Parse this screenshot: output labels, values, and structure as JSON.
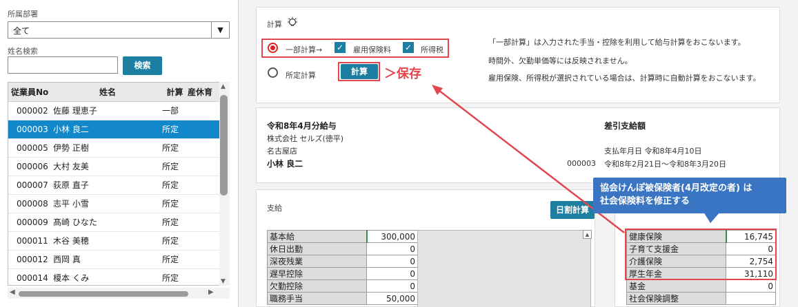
{
  "left": {
    "dept_label": "所属部署",
    "dept_value": "全て",
    "name_search_label": "姓名検索",
    "name_search_value": "",
    "search_button": "検索",
    "columns": [
      "従業員No",
      "姓名",
      "計算",
      "産休育"
    ],
    "rows": [
      {
        "no": "000002",
        "name": "佐藤 理恵子",
        "calc": "一部"
      },
      {
        "no": "000003",
        "name": "小林 良二",
        "calc": "所定"
      },
      {
        "no": "000005",
        "name": "伊勢 正樹",
        "calc": "所定"
      },
      {
        "no": "000006",
        "name": "大村 友美",
        "calc": "所定"
      },
      {
        "no": "000007",
        "name": "荻原 直子",
        "calc": "所定"
      },
      {
        "no": "000008",
        "name": "志平 小雪",
        "calc": "所定"
      },
      {
        "no": "000009",
        "name": "髙崎 ひなた",
        "calc": "所定"
      },
      {
        "no": "000011",
        "name": "木谷 美穂",
        "calc": "所定"
      },
      {
        "no": "000012",
        "name": "西岡 真",
        "calc": "所定"
      },
      {
        "no": "000014",
        "name": "榎本 くみ",
        "calc": "所定"
      }
    ]
  },
  "calc_panel": {
    "title": "計算",
    "partial_calc": "一部計算→",
    "employment_insurance": "雇用保険料",
    "income_tax": "所得税",
    "standard_calc": "所定計算",
    "calc_button": "計算",
    "save_annotation": "＞保存",
    "info_line1": "「一部計算」は入力された手当・控除を利用して給与計算をおこないます。",
    "info_line2": "時間外、欠勤単価等には反映されません。",
    "info_line3": "雇用保険、所得税が選択されている場合は、計算時に自動計算をおこないます。"
  },
  "header": {
    "pay_title": "令和8年4月分給与",
    "company": "株式会社 セルズ(徳平)",
    "branch": "名古屋店",
    "employee_name": "小林 良二",
    "employee_no": "000003",
    "net_pay_label": "差引支給額",
    "pay_date": "支払年月日 令和8年4月10日",
    "period": "令和8年2月21日～令和8年3月20日"
  },
  "payments": {
    "title": "支給",
    "daily_button": "日割計算",
    "rows": [
      {
        "label": "基本給",
        "value": "300,000"
      },
      {
        "label": "休日出勤",
        "value": "0"
      },
      {
        "label": "深夜残業",
        "value": "0"
      },
      {
        "label": "遅早控除",
        "value": "0"
      },
      {
        "label": "欠勤控除",
        "value": "0"
      },
      {
        "label": "職務手当",
        "value": "50,000"
      }
    ]
  },
  "deductions": {
    "rows": [
      {
        "label": "健康保険",
        "value": "16,745"
      },
      {
        "label": "子育て支援金",
        "value": "0"
      },
      {
        "label": "介護保険",
        "value": "2,754"
      },
      {
        "label": "厚生年金",
        "value": "31,110"
      },
      {
        "label": "基金",
        "value": "0"
      },
      {
        "label": "社会保険調整",
        "value": ""
      }
    ]
  },
  "callout": {
    "line1": "協会けんぽ被保険者(4月改定の者) は",
    "line2": "社会保険料を修正する"
  },
  "colors": {
    "teal": "#1c7ea0",
    "selected_row": "#1287c9",
    "red": "#e0464b",
    "callout": "#3a75c4"
  }
}
